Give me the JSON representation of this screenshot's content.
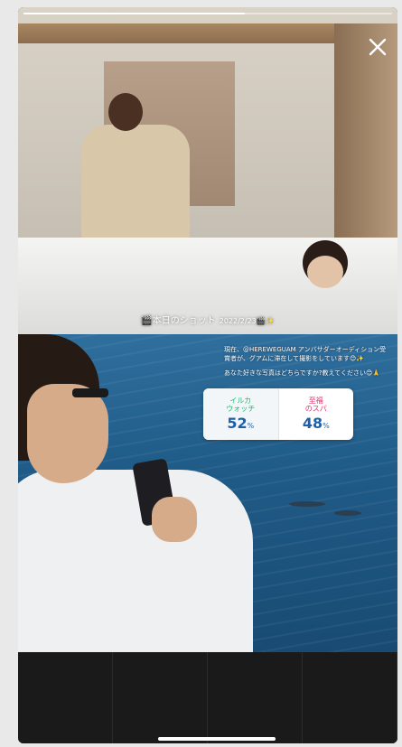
{
  "story": {
    "progress_fraction": 0.6,
    "close_icon": "close-icon"
  },
  "top_photo": {
    "caption_title": "🎬本日のショット",
    "caption_date": "2022/2/23🎬✨"
  },
  "bottom_photo": {
    "text_line1": "現在、@HEREWEGUAM アンバサダーオーディション受賞者が、グアムに滞在して撮影をしています😊✨",
    "text_line2": "あなた好きな写真はどちらですか?教えてください😊🙏"
  },
  "poll": {
    "options": [
      {
        "label": "イルカ\nウォッチ",
        "percent": "52",
        "unit": "%",
        "color": "#2bb673"
      },
      {
        "label": "至福\nのスパ",
        "percent": "48",
        "unit": "%",
        "color": "#e2336b"
      }
    ]
  }
}
